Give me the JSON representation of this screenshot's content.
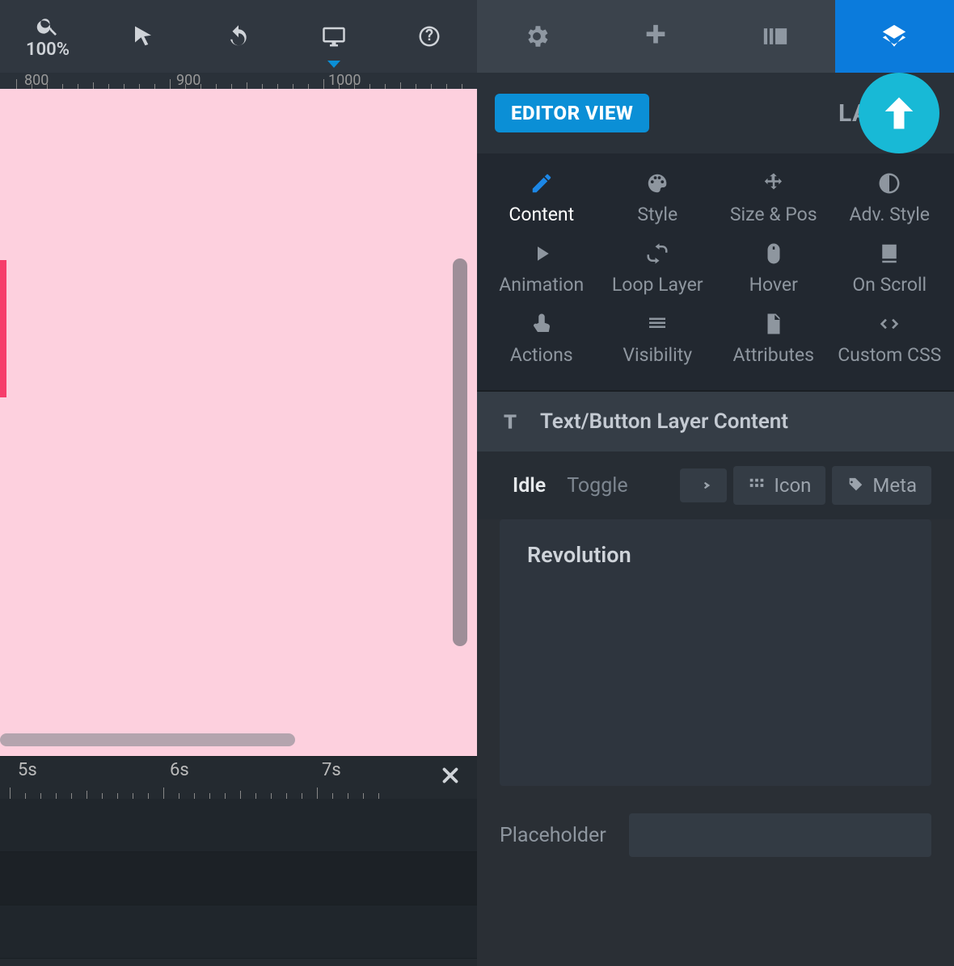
{
  "toolbar": {
    "zoom_label": "100%"
  },
  "ruler": {
    "marks": [
      "800",
      "900",
      "1000"
    ]
  },
  "timeline": {
    "marks": [
      "5s",
      "6s",
      "7s"
    ]
  },
  "panel": {
    "editor_view_label": "EDITOR VIEW",
    "layer_options_partial": "LAYER O"
  },
  "property_tabs": {
    "content": "Content",
    "style": "Style",
    "sizepos": "Size & Pos",
    "advstyle": "Adv. Style",
    "animation": "Animation",
    "looplayer": "Loop Layer",
    "hover": "Hover",
    "onscroll": "On Scroll",
    "actions": "Actions",
    "visibility": "Visibility",
    "attributes": "Attributes",
    "customcss": "Custom CSS"
  },
  "section": {
    "title": "Text/Button Layer Content"
  },
  "content_tabs": {
    "idle": "Idle",
    "toggle": "Toggle",
    "icon": "Icon",
    "meta": "Meta"
  },
  "content": {
    "text_value": "Revolution",
    "placeholder_label": "Placeholder",
    "placeholder_value": ""
  }
}
